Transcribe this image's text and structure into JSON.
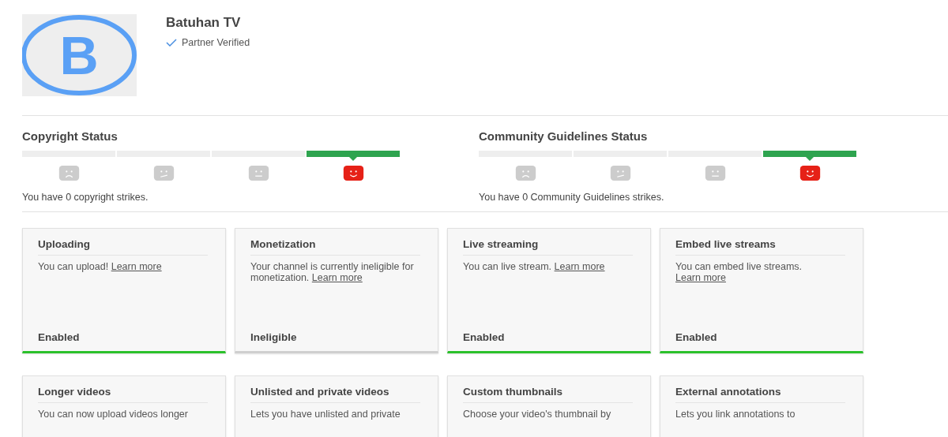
{
  "channel": {
    "avatar_letter": "B",
    "name": "Batuhan TV",
    "badge": "Partner Verified"
  },
  "statuses": [
    {
      "title": "Copyright Status",
      "segments": [
        {
          "kind": "sad",
          "selected": false
        },
        {
          "kind": "skeptical",
          "selected": false
        },
        {
          "kind": "neutral",
          "selected": false
        },
        {
          "kind": "happy",
          "selected": true
        }
      ],
      "summary": "You have 0 copyright strikes."
    },
    {
      "title": "Community Guidelines Status",
      "segments": [
        {
          "kind": "sad",
          "selected": false
        },
        {
          "kind": "skeptical",
          "selected": false
        },
        {
          "kind": "neutral",
          "selected": false
        },
        {
          "kind": "happy",
          "selected": true
        }
      ],
      "summary": "You have 0 Community Guidelines strikes."
    }
  ],
  "features": [
    {
      "title": "Uploading",
      "text": "You can upload!",
      "link": "Learn more",
      "status": "Enabled",
      "enabled": true
    },
    {
      "title": "Monetization",
      "text": "Your channel is currently ineligible for monetization.",
      "link": "Learn more",
      "status": "Ineligible",
      "enabled": false
    },
    {
      "title": "Live streaming",
      "text": "You can live stream.",
      "link": "Learn more",
      "status": "Enabled",
      "enabled": true
    },
    {
      "title": "Embed live streams",
      "text": "You can embed live streams.",
      "link": "Learn more",
      "status": "Enabled",
      "enabled": true
    },
    {
      "title": "Longer videos",
      "text": "You can now upload videos longer"
    },
    {
      "title": "Unlisted and private videos",
      "text": "Lets you have unlisted and private"
    },
    {
      "title": "Custom thumbnails",
      "text": "Choose your video's thumbnail by"
    },
    {
      "title": "External annotations",
      "text": "Lets you link annotations to"
    }
  ]
}
